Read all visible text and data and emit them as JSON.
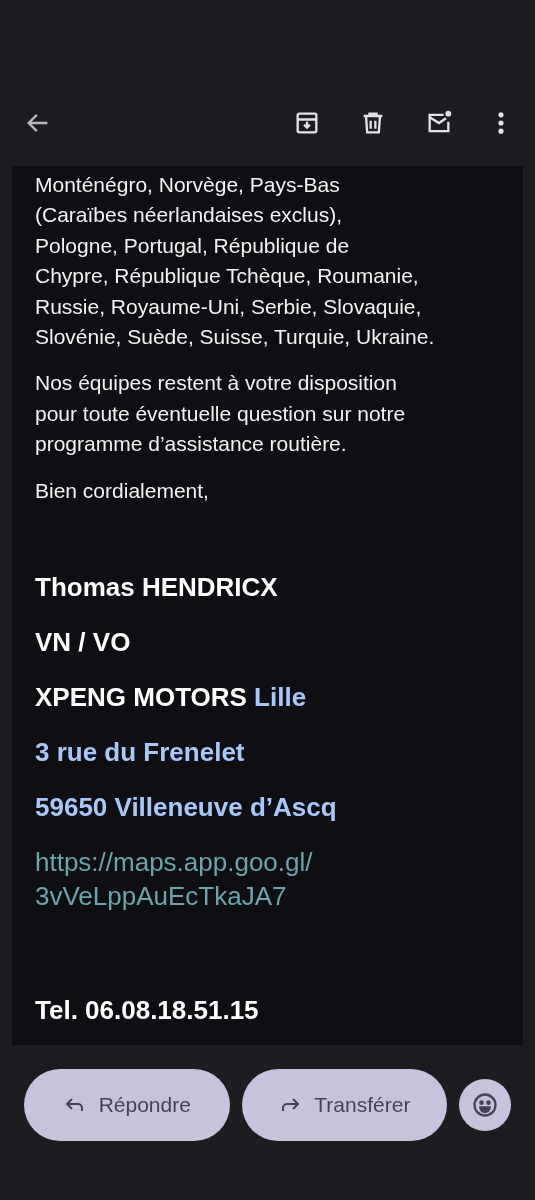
{
  "toolbar": {
    "actions": [
      {
        "kind": "archive"
      },
      {
        "kind": "delete"
      },
      {
        "kind": "mark_unread"
      },
      {
        "kind": "more"
      }
    ]
  },
  "body": {
    "paragraphs": [
      [
        "Monténégro, Norvège, Pays-Bas",
        "(Caraïbes néerlandaises exclus),",
        "Pologne, Portugal, République de",
        "Chypre, République Tchèque, Roumanie,",
        "Russie, Royaume-Uni, Serbie, Slovaquie,",
        "Slovénie, Suède, Suisse, Turquie, Ukraine."
      ],
      [
        "Nos équipes restent à votre disposition",
        "pour toute éventuelle question sur notre",
        "programme d’assistance routière."
      ],
      [
        "Bien cordialement,"
      ]
    ],
    "signature": [
      [
        {
          "text": "Thomas HENDRICX",
          "linked": false
        }
      ],
      [
        {
          "text": "VN / VO",
          "linked": false
        }
      ],
      [
        {
          "text": "XPENG MOTORS",
          "linked": false
        },
        {
          "text": "Lille",
          "linked": true
        }
      ],
      [
        {
          "text": "3 rue du Frenelet",
          "linked": true
        }
      ],
      [
        {
          "text": "59650 Villeneuve d’Ascq",
          "linked": true
        }
      ]
    ],
    "link": [
      "https://maps.app.goo.gl/",
      "3vVeLppAuEcTkaJA7"
    ],
    "phone": "Tel. 06.08.18.51.15"
  },
  "actions": [
    {
      "kind": "reply",
      "label": "Répondre"
    },
    {
      "kind": "forward",
      "label": "Transférer"
    },
    {
      "kind": "emoji"
    }
  ]
}
